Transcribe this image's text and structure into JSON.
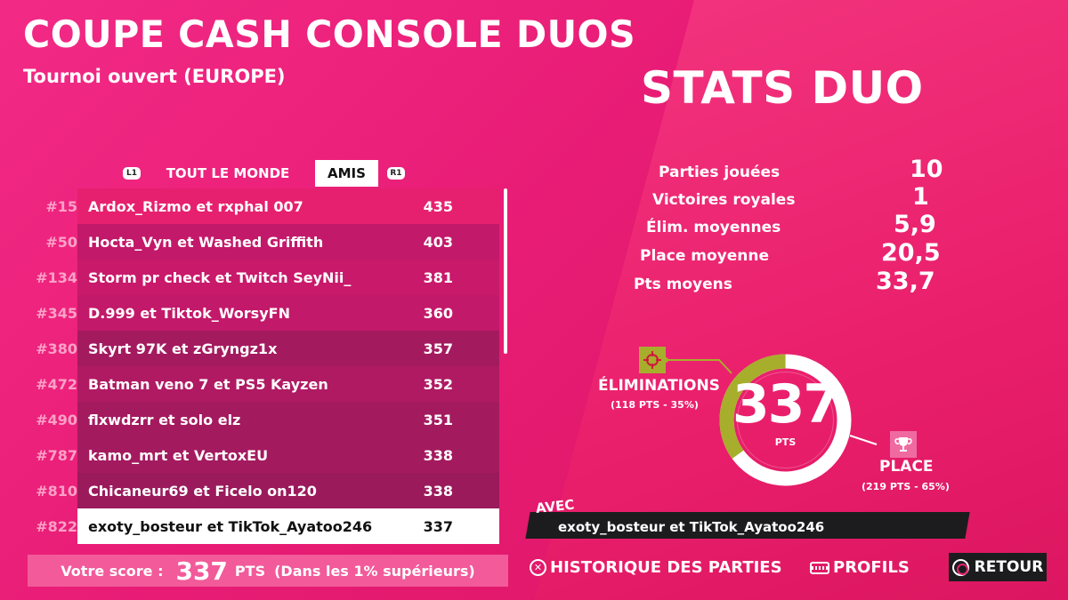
{
  "header": {
    "title": "COUPE CASH CONSOLE DUOS",
    "subtitle": "Tournoi ouvert (EUROPE)"
  },
  "tabs": {
    "left_badge": "L1",
    "right_badge": "R1",
    "all_label": "TOUT LE MONDE",
    "friends_label": "AMIS"
  },
  "leaderboard": [
    {
      "rank": "#15",
      "name": "Ardox_Rizmo et rxphal 007",
      "score": "435"
    },
    {
      "rank": "#50",
      "name": "Hocta_Vyn et Washed Griffith",
      "score": "403"
    },
    {
      "rank": "#134",
      "name": "Storm pr check et Twitch SeyNii_",
      "score": "381"
    },
    {
      "rank": "#345",
      "name": "D.999 et Tiktok_WorsyFN",
      "score": "360"
    },
    {
      "rank": "#380",
      "name": "Skyrt 97K et zGryngz1x",
      "score": "357"
    },
    {
      "rank": "#472",
      "name": "Batman veno 7 et PS5 Kayzen",
      "score": "352"
    },
    {
      "rank": "#490",
      "name": "flxwdzrr et solo elz",
      "score": "351"
    },
    {
      "rank": "#787",
      "name": "kamo_mrt et VertoxEU",
      "score": "338"
    },
    {
      "rank": "#810",
      "name": "Chicaneur69 et Ficelo on120",
      "score": "338"
    },
    {
      "rank": "#822",
      "name": "exoty_bosteur et TikTok_Ayatoo246",
      "score": "337",
      "highlight": true
    }
  ],
  "your_score": {
    "label": "Votre score :",
    "value": "337",
    "unit": "PTS",
    "note": "(Dans les 1% supérieurs)"
  },
  "stats": {
    "title": "STATS DUO",
    "rows": [
      {
        "label": "Parties jouées",
        "value": "10"
      },
      {
        "label": "Victoires royales",
        "value": "1"
      },
      {
        "label": "Élim. moyennes",
        "value": "5,9"
      },
      {
        "label": "Place moyenne",
        "value": "20,5"
      },
      {
        "label": "Pts moyens",
        "value": "33,7"
      }
    ]
  },
  "breakdown": {
    "total": "337",
    "unit": "PTS",
    "eliminations": {
      "label": "ÉLIMINATIONS",
      "detail": "(118 PTS - 35%)",
      "fraction": 0.35,
      "color": "#a7ae2c",
      "icon": "crosshair-icon"
    },
    "place": {
      "label": "PLACE",
      "detail": "(219 PTS - 65%)",
      "fraction": 0.65,
      "color": "#ffffff",
      "icon": "trophy-icon"
    }
  },
  "teammate": {
    "label": "AVEC",
    "name": "exoty_bosteur et TikTok_Ayatoo246"
  },
  "nav": {
    "history_label": "HISTORIQUE DES PARTIES",
    "profiles_label": "PROFILS",
    "back_label": "RETOUR"
  }
}
